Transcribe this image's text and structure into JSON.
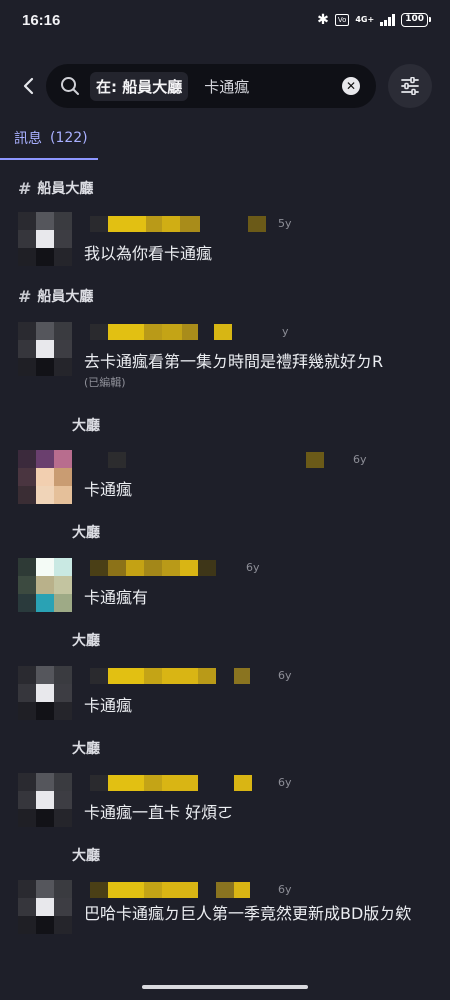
{
  "status_bar": {
    "time": "16:16",
    "network": "4G+",
    "battery": "100"
  },
  "search": {
    "scope": "在: 船員大廳",
    "query": "卡通瘋",
    "clear_icon": "close-icon",
    "filter_icon": "sliders-icon"
  },
  "tabs": {
    "messages_label": "訊息",
    "messages_count": "(122)"
  },
  "results": {
    "channel_1": "船員大廳",
    "msg_1": {
      "time": "5y",
      "text": "我以為你看卡通瘋"
    },
    "channel_2": "船員大廳",
    "msg_2": {
      "time": "y",
      "text": "去卡通瘋看第一集ㄉ時間是禮拜幾就好ㄉR",
      "edited": "(已編輯)"
    },
    "channel_3": "大廳",
    "msg_3": {
      "time": "6y",
      "text": "卡通瘋"
    },
    "channel_4": "大廳",
    "msg_4": {
      "time": "6y",
      "text": "卡通瘋有"
    },
    "channel_5": "大廳",
    "msg_5": {
      "time": "6y",
      "text": "卡通瘋"
    },
    "channel_6": "大廳",
    "msg_6": {
      "time": "6y",
      "text": "卡通瘋一直卡 好煩ㄛ"
    },
    "channel_7": "大廳",
    "msg_7": {
      "time": "6y",
      "text": "巴哈卡通瘋ㄉ巨人第一季竟然更新成BD版ㄉ欸"
    }
  },
  "colors": {
    "background": "#1e1f29",
    "accent": "#a9b0ff",
    "name_redaction": "#d9b514"
  }
}
